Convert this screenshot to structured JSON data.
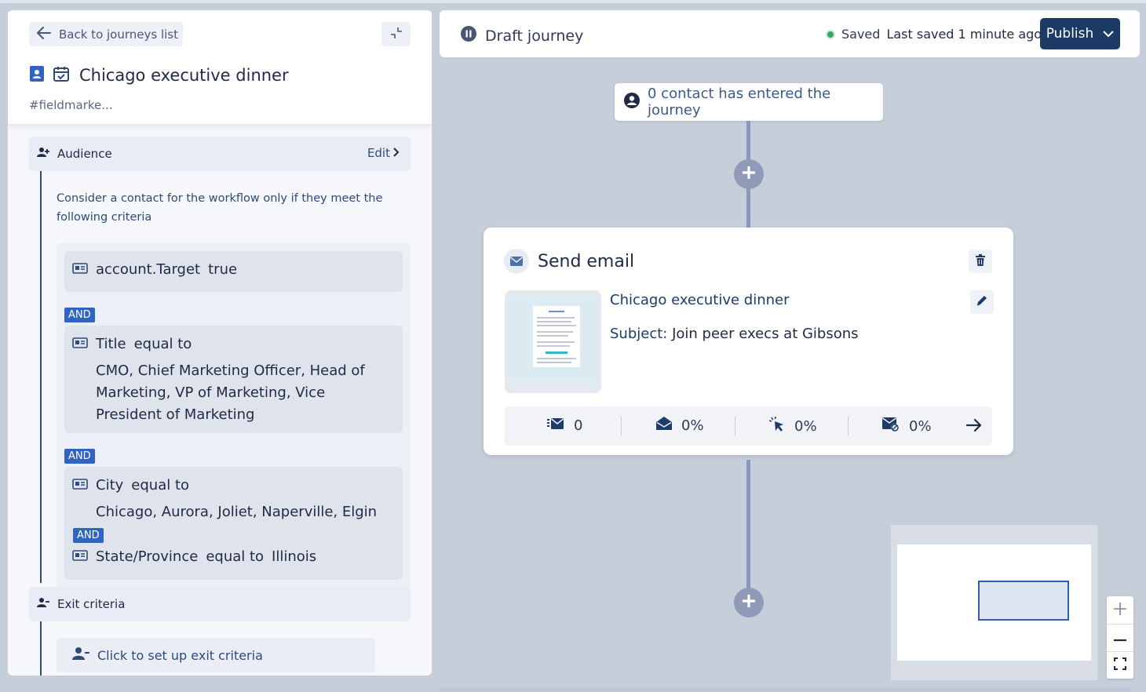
{
  "left_panel": {
    "back_label": "Back to journeys list",
    "journey_title": "Chicago executive dinner",
    "hashtag": "#fieldmarke...",
    "audience": {
      "label": "Audience",
      "edit_label": "Edit",
      "description": "Consider a contact for the workflow only if they meet the following criteria",
      "conditions": [
        {
          "field": "account.Target",
          "operator": "",
          "value": "true"
        },
        {
          "field": "Title",
          "operator": "equal to",
          "value": "CMO, Chief Marketing Officer, Head of Marketing, VP of Marketing, Vice President of Marketing"
        },
        {
          "field": "City",
          "operator": "equal to",
          "value": "Chicago, Aurora, Joliet, Naperville, Elgin"
        },
        {
          "field": "State/Province",
          "operator": "equal to",
          "value": "Illinois"
        }
      ],
      "and_label": "AND"
    },
    "exit_criteria": {
      "label": "Exit criteria",
      "cta": "Click to set up exit criteria"
    }
  },
  "topbar": {
    "status": "Draft journey",
    "saved_label": "Saved",
    "last_saved": "Last saved 1 minute ago",
    "publish_label": "Publish"
  },
  "canvas": {
    "entry_text": "0 contact has entered the journey",
    "email_step": {
      "title": "Send email",
      "email_name": "Chicago executive dinner",
      "subject_label": "Subject:",
      "subject": "Join peer execs at Gibsons",
      "stats": {
        "sent": "0",
        "opened": "0%",
        "clicked": "0%",
        "unsubscribed": "0%"
      }
    }
  },
  "icons": [
    "arrow-left-icon",
    "collapse-icon",
    "contact-card-icon",
    "calendar-check-icon",
    "person-add-icon",
    "chevron-right-icon",
    "id-card-icon",
    "person-minus-icon",
    "pause-icon",
    "chevron-down-icon",
    "user-circle-icon",
    "plus-icon",
    "envelope-icon",
    "trash-icon",
    "pencil-icon",
    "sent-icon",
    "opened-icon",
    "click-icon",
    "unsubscribe-icon",
    "arrow-right-icon",
    "zoom-in-icon",
    "zoom-out-icon",
    "fit-view-icon"
  ],
  "colors": {
    "primary": "#1c3a66",
    "accent_blue": "#2f64c2",
    "saved_green": "#3aa36b",
    "canvas_bg": "#c6ceda",
    "connector": "#8997b9"
  }
}
